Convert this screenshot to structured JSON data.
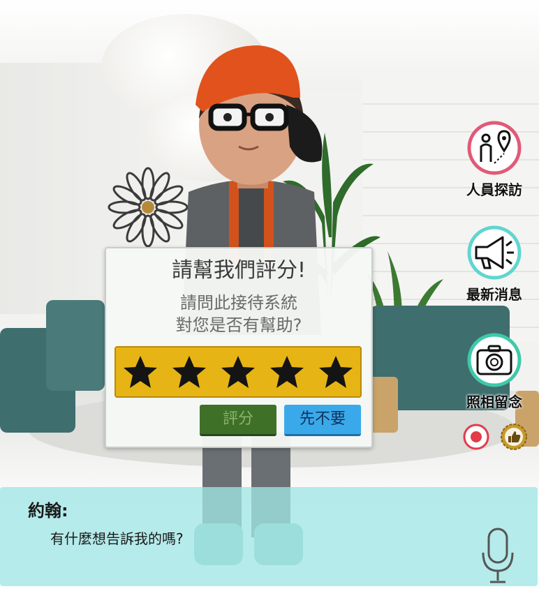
{
  "rating_dialog": {
    "title": "請幫我們評分!",
    "question_line1": "請問此接待系統",
    "question_line2": "對您是否有幫助?",
    "star_count": 5,
    "rate_button": "評分",
    "skip_button": "先不要"
  },
  "side_menu": {
    "items": [
      {
        "label": "人員探訪",
        "icon": "person-location-icon",
        "ring_color": "#e05a77"
      },
      {
        "label": "最新消息",
        "icon": "megaphone-icon",
        "ring_color": "#5fd6cf"
      },
      {
        "label": "照相留念",
        "icon": "camera-icon",
        "ring_color": "#3ec9a8"
      }
    ],
    "record_icon": "record-icon",
    "like_icon": "thumbs-up-badge-icon"
  },
  "chat": {
    "speaker": "約翰:",
    "message": "有什麼想告訴我的嗎?",
    "mic_icon": "microphone-icon"
  },
  "colors": {
    "star_bar": "#e6b414",
    "rate_button": "#3e7028",
    "skip_button": "#3aa9ea",
    "chat_bar": "#a0e6e4"
  }
}
